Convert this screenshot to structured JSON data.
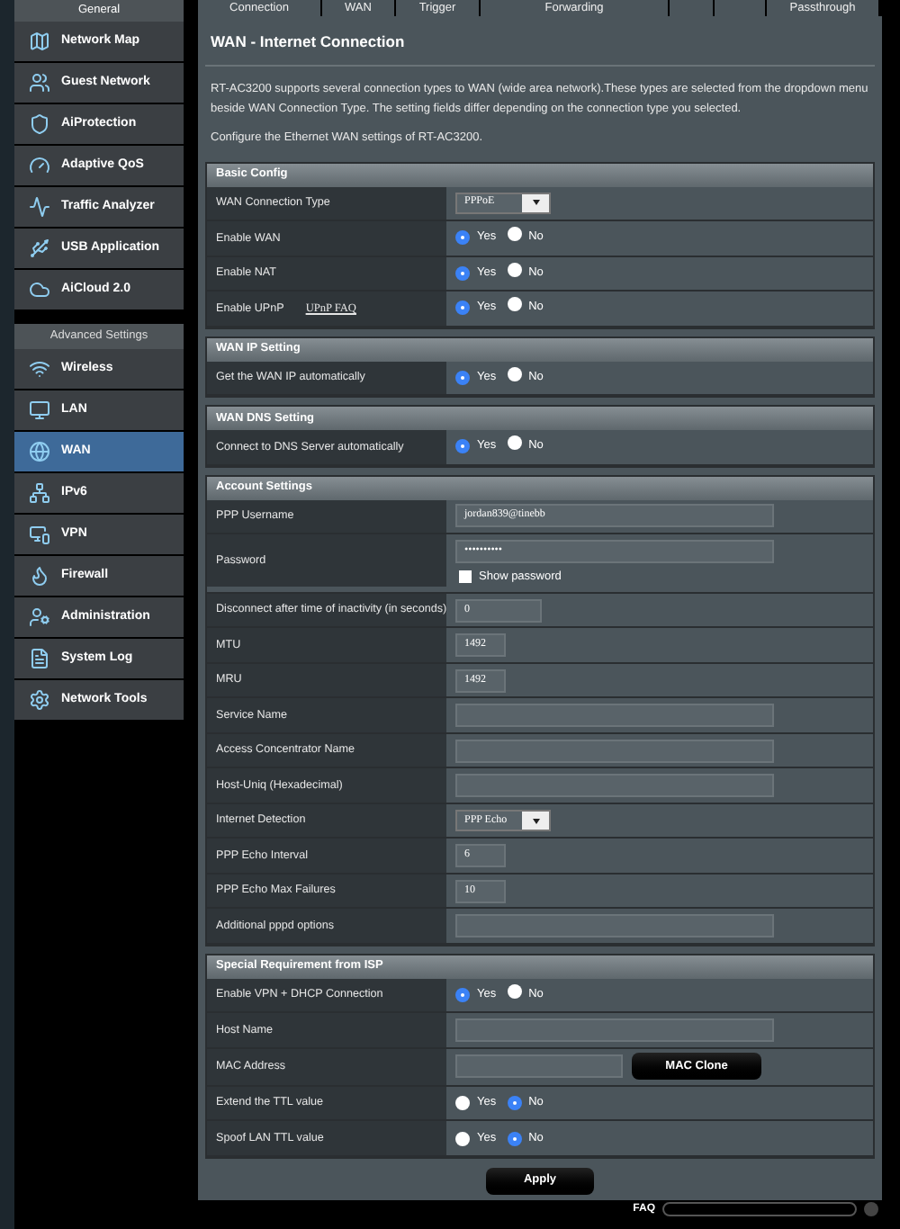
{
  "tabs": [
    {
      "kind": "label",
      "label": "Connection"
    },
    {
      "kind": "label",
      "label": "WAN"
    },
    {
      "kind": "label",
      "label": "Trigger"
    },
    {
      "kind": "label",
      "label": "Forwarding"
    },
    {
      "kind": "blank"
    },
    {
      "kind": "blank"
    },
    {
      "kind": "label",
      "label": "Passthrough"
    }
  ],
  "sidebar": {
    "general": {
      "title": "General",
      "items": [
        {
          "label": "Network Map",
          "selected": false
        },
        {
          "label": "Guest Network",
          "selected": false
        },
        {
          "label": "AiProtection",
          "selected": false
        },
        {
          "label": "Adaptive QoS",
          "selected": false
        },
        {
          "label": "Traffic Analyzer",
          "selected": false
        },
        {
          "label": "USB Application",
          "selected": false
        },
        {
          "label": "AiCloud 2.0",
          "selected": false
        }
      ]
    },
    "advanced": {
      "title": "Advanced Settings",
      "items": [
        {
          "label": "Wireless",
          "selected": false
        },
        {
          "label": "LAN",
          "selected": false
        },
        {
          "label": "WAN",
          "selected": true
        },
        {
          "label": "IPv6",
          "selected": false
        },
        {
          "label": "VPN",
          "selected": false
        },
        {
          "label": "Firewall",
          "selected": false
        },
        {
          "label": "Administration",
          "selected": false
        },
        {
          "label": "System Log",
          "selected": false
        },
        {
          "label": "Network Tools",
          "selected": false
        }
      ]
    }
  },
  "title": "WAN - Internet Connection",
  "description": "RT-AC3200 supports several connection types to WAN (wide area network).These types are selected from the dropdown menu beside WAN Connection Type. The setting fields differ depending on the connection type you selected.",
  "note": "Configure the Ethernet WAN settings of RT-AC3200.",
  "sections": [
    {
      "title": "Basic Config",
      "rows": [
        {
          "kind": "select",
          "label": "WAN Connection Type",
          "value": "PPPoE"
        },
        {
          "kind": "radio",
          "label": "Enable WAN",
          "yes": "Yes",
          "no": "No",
          "selected_yes": true
        },
        {
          "kind": "radio",
          "label": "Enable NAT",
          "yes": "Yes",
          "no": "No",
          "selected_yes": true
        },
        {
          "kind": "radio",
          "label": "Enable UPnP",
          "link": "UPnP FAQ",
          "yes": "Yes",
          "no": "No",
          "selected_yes": true
        }
      ]
    },
    {
      "title": "WAN IP Setting",
      "rows": [
        {
          "kind": "radio",
          "label": "Get the WAN IP automatically",
          "yes": "Yes",
          "no": "No",
          "selected_yes": true
        }
      ]
    },
    {
      "title": "WAN DNS Setting",
      "rows": [
        {
          "kind": "radio",
          "label": "Connect to DNS Server automatically",
          "yes": "Yes",
          "no": "No",
          "selected_yes": true
        }
      ]
    },
    {
      "title": "Account Settings",
      "rows": [
        {
          "kind": "text",
          "label": "PPP Username",
          "value": "jordan839@tinebb"
        },
        {
          "kind": "password",
          "label": "Password",
          "value": "••••••••••",
          "checkbox": "Show password",
          "checked": false
        },
        {
          "kind": "medium_text",
          "label": "Disconnect after time of inactivity (in seconds)",
          "value": "0"
        },
        {
          "kind": "short_text",
          "label": "MTU",
          "value": "1492"
        },
        {
          "kind": "short_text",
          "label": "MRU",
          "value": "1492"
        },
        {
          "kind": "text",
          "label": "Service Name"
        },
        {
          "kind": "text",
          "label": "Access Concentrator Name"
        },
        {
          "kind": "text",
          "label": "Host-Uniq (Hexadecimal)"
        },
        {
          "kind": "select",
          "label": "Internet Detection",
          "value": "PPP Echo"
        },
        {
          "kind": "short_text",
          "label": "PPP Echo Interval",
          "value": "6"
        },
        {
          "kind": "short_text",
          "label": "PPP Echo Max Failures",
          "value": "10"
        },
        {
          "kind": "text",
          "label": "Additional pppd options"
        }
      ]
    },
    {
      "title": "Special Requirement from ISP",
      "rows": [
        {
          "kind": "radio",
          "label": "Enable VPN + DHCP Connection",
          "yes": "Yes",
          "no": "No",
          "selected_yes": true
        },
        {
          "kind": "text",
          "label": "Host Name"
        },
        {
          "kind": "mac",
          "label": "MAC Address",
          "button": "MAC Clone"
        },
        {
          "kind": "radio",
          "label": "Extend the TTL value",
          "yes": "Yes",
          "no": "No",
          "selected_yes": false
        },
        {
          "kind": "radio",
          "label": "Spoof LAN TTL value",
          "yes": "Yes",
          "no": "No",
          "selected_yes": false
        }
      ]
    }
  ],
  "apply": "Apply",
  "footer": {
    "label": "FAQ"
  }
}
